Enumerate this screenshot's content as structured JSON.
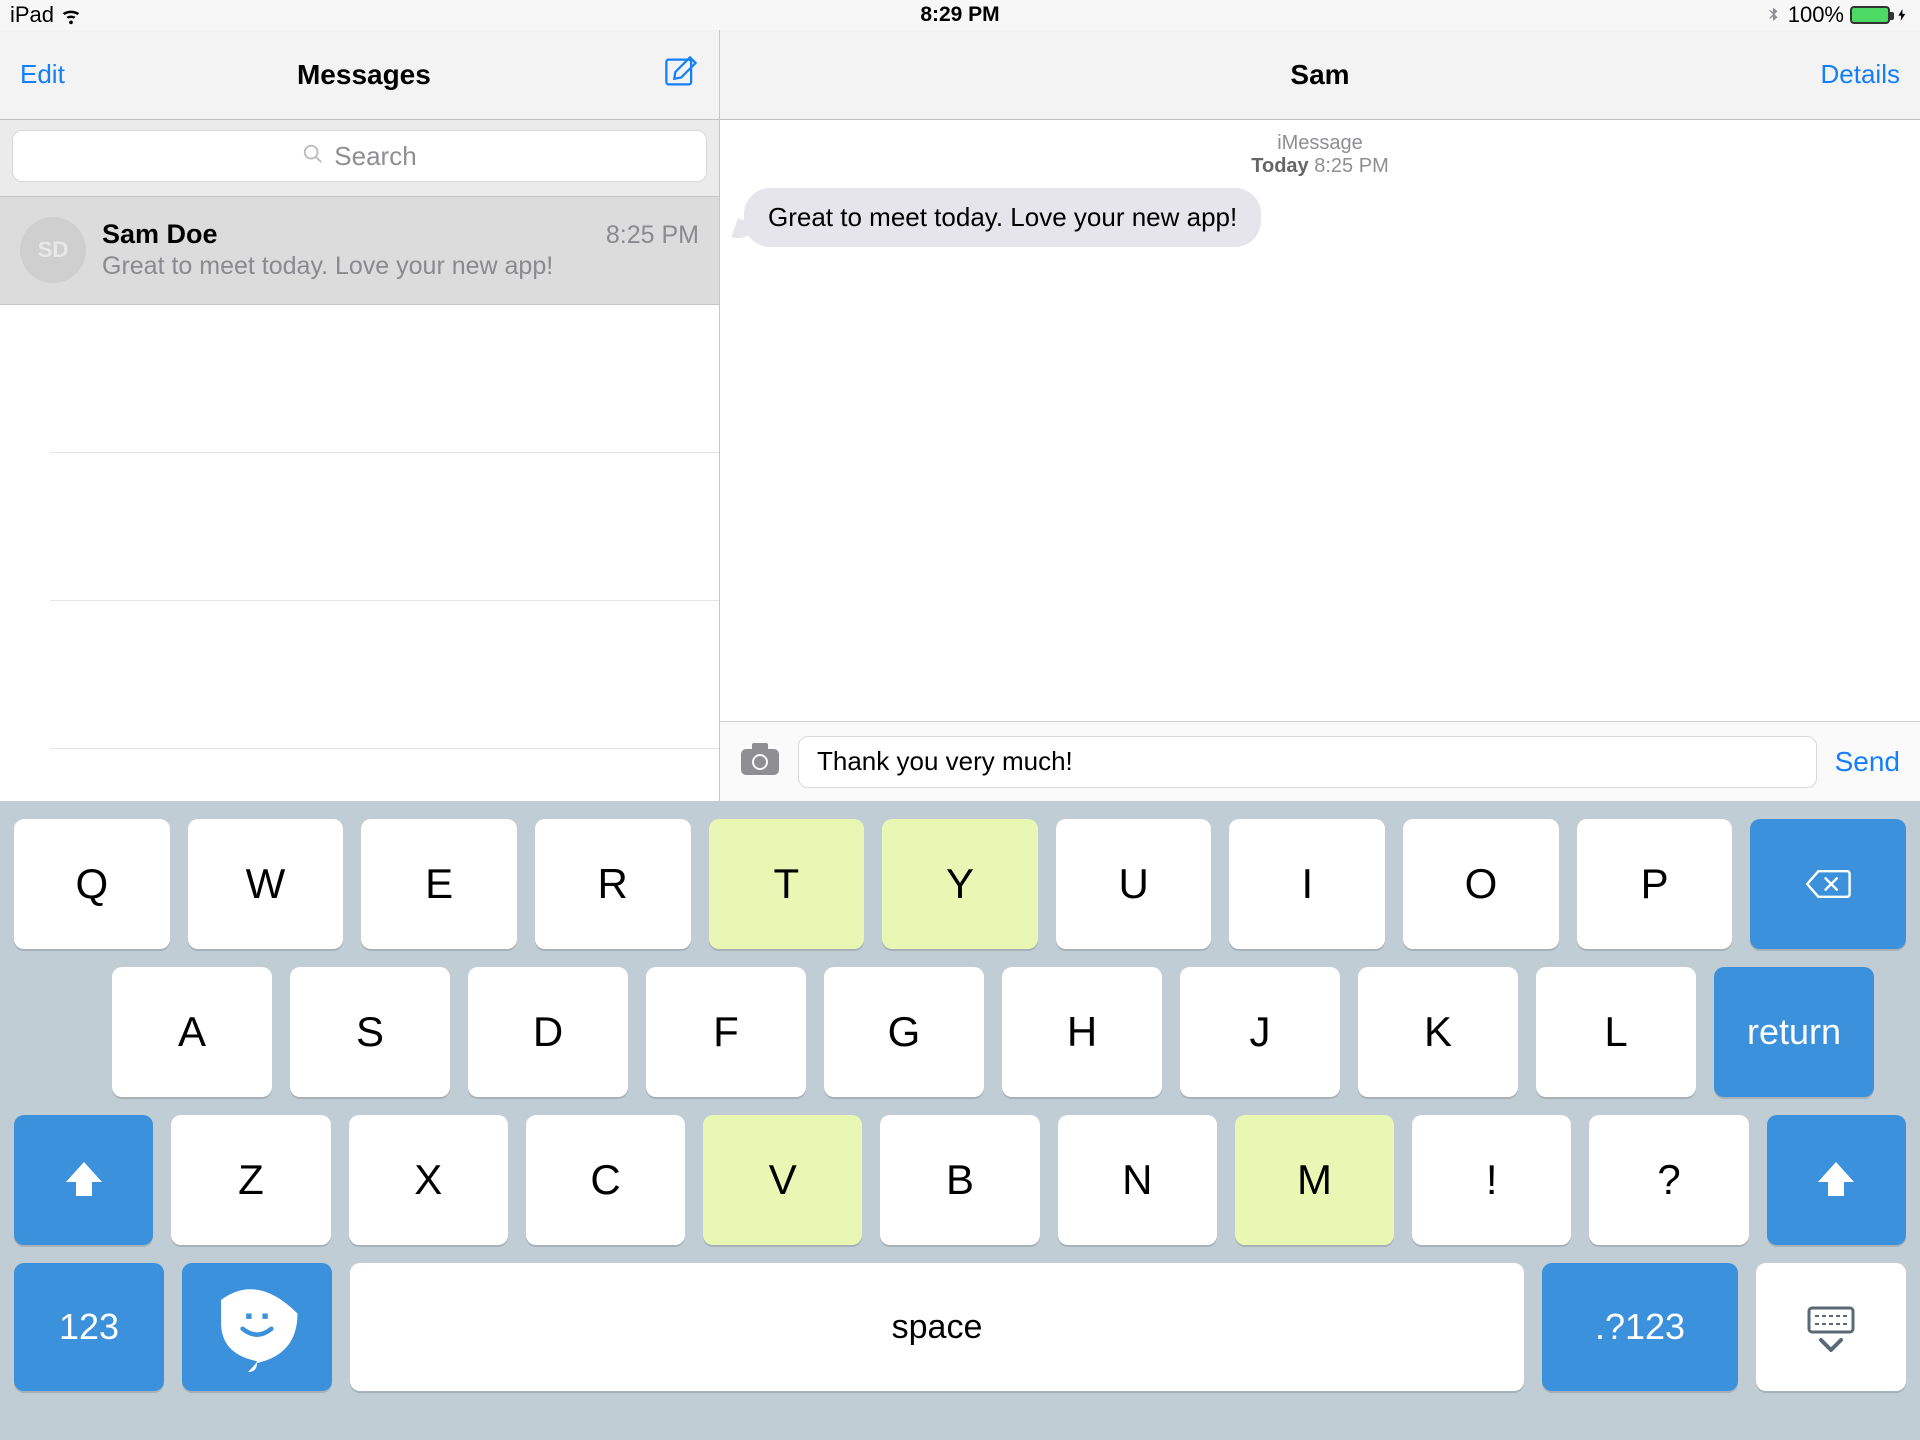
{
  "status": {
    "device": "iPad",
    "time": "8:29 PM",
    "batteryPercent": "100%"
  },
  "sidebar": {
    "edit": "Edit",
    "title": "Messages",
    "search_placeholder": "Search",
    "thread": {
      "initials": "SD",
      "name": "Sam Doe",
      "time": "8:25 PM",
      "preview": "Great to meet today. Love your new app!"
    }
  },
  "conversation": {
    "title": "Sam",
    "details": "Details",
    "meta_service": "iMessage",
    "meta_day": "Today",
    "meta_time": "8:25 PM",
    "messages": [
      {
        "from": "them",
        "text": "Great to meet today. Love your new app!"
      }
    ],
    "composer_value": "Thank you very much!",
    "send": "Send"
  },
  "keyboard": {
    "row1": [
      "Q",
      "W",
      "E",
      "R",
      "T",
      "Y",
      "U",
      "I",
      "O",
      "P"
    ],
    "row1_hl": [
      "T",
      "Y"
    ],
    "row2": [
      "A",
      "S",
      "D",
      "F",
      "G",
      "H",
      "J",
      "K",
      "L"
    ],
    "row3": [
      "Z",
      "X",
      "C",
      "V",
      "B",
      "N",
      "M",
      "!",
      "?"
    ],
    "row3_hl": [
      "V",
      "M"
    ],
    "numLabel": "123",
    "spaceLabel": "space",
    "symLabel": ".?123",
    "returnLabel": "return"
  }
}
